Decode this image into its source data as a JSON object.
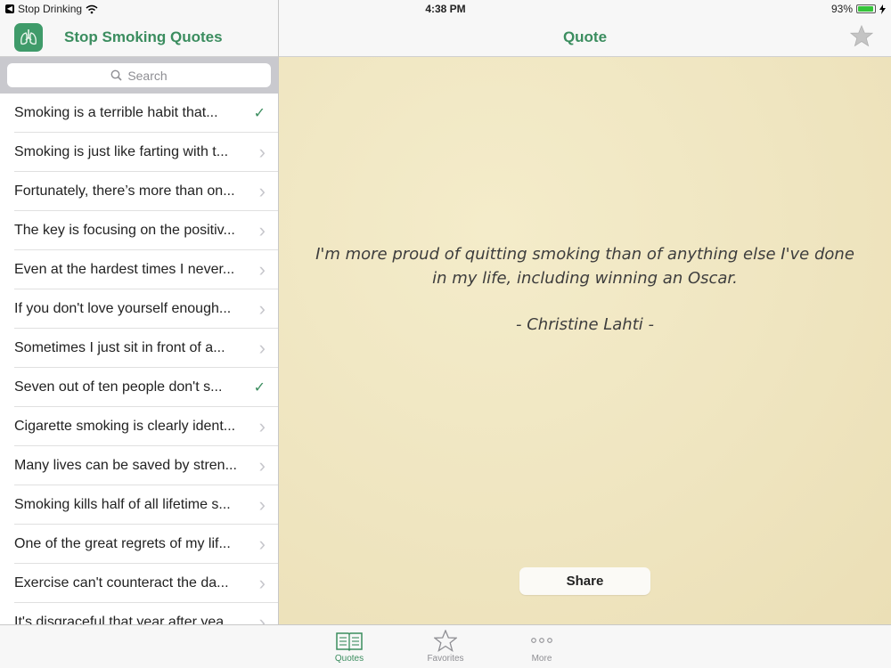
{
  "status_bar": {
    "back_app": "Stop Drinking",
    "time": "4:38 PM",
    "battery": "93%",
    "battery_level": 0.93
  },
  "sidebar": {
    "app_title": "Stop Smoking Quotes",
    "search_placeholder": "Search",
    "items": [
      {
        "text": "Smoking is a terrible habit that...",
        "accessory": "check"
      },
      {
        "text": "Smoking is just like farting with t...",
        "accessory": "chevron"
      },
      {
        "text": "Fortunately, there’s more than on...",
        "accessory": "chevron"
      },
      {
        "text": "The key is focusing on the positiv...",
        "accessory": "chevron"
      },
      {
        "text": "Even at the hardest times I never...",
        "accessory": "chevron"
      },
      {
        "text": "If you don't love yourself enough...",
        "accessory": "chevron"
      },
      {
        "text": "Sometimes I just sit in front of a...",
        "accessory": "chevron"
      },
      {
        "text": "Seven out of ten people don't s...",
        "accessory": "check"
      },
      {
        "text": "Cigarette smoking is clearly ident...",
        "accessory": "chevron"
      },
      {
        "text": "Many lives can be saved by stren...",
        "accessory": "chevron"
      },
      {
        "text": "Smoking kills half of all lifetime s...",
        "accessory": "chevron"
      },
      {
        "text": "One of the great regrets of my lif...",
        "accessory": "chevron"
      },
      {
        "text": "Exercise can't counteract the da...",
        "accessory": "chevron"
      },
      {
        "text": "It's disgraceful that year after yea...",
        "accessory": "chevron"
      }
    ]
  },
  "main": {
    "title": "Quote",
    "quote_line1": "I'm more proud of quitting smoking than of anything else I've done",
    "quote_line2": "in my life, including winning an Oscar.",
    "author": "-  Christine Lahti  -",
    "share_label": "Share"
  },
  "tab_bar": {
    "tabs": [
      {
        "label": "Quotes",
        "icon": "book-icon",
        "active": true
      },
      {
        "label": "Favorites",
        "icon": "star-icon",
        "active": false
      },
      {
        "label": "More",
        "icon": "more-icon",
        "active": false
      }
    ]
  },
  "colors": {
    "accent": "#3b8d5f",
    "parchment": "#f1e8c4",
    "chevron": "#c7c7cc"
  }
}
